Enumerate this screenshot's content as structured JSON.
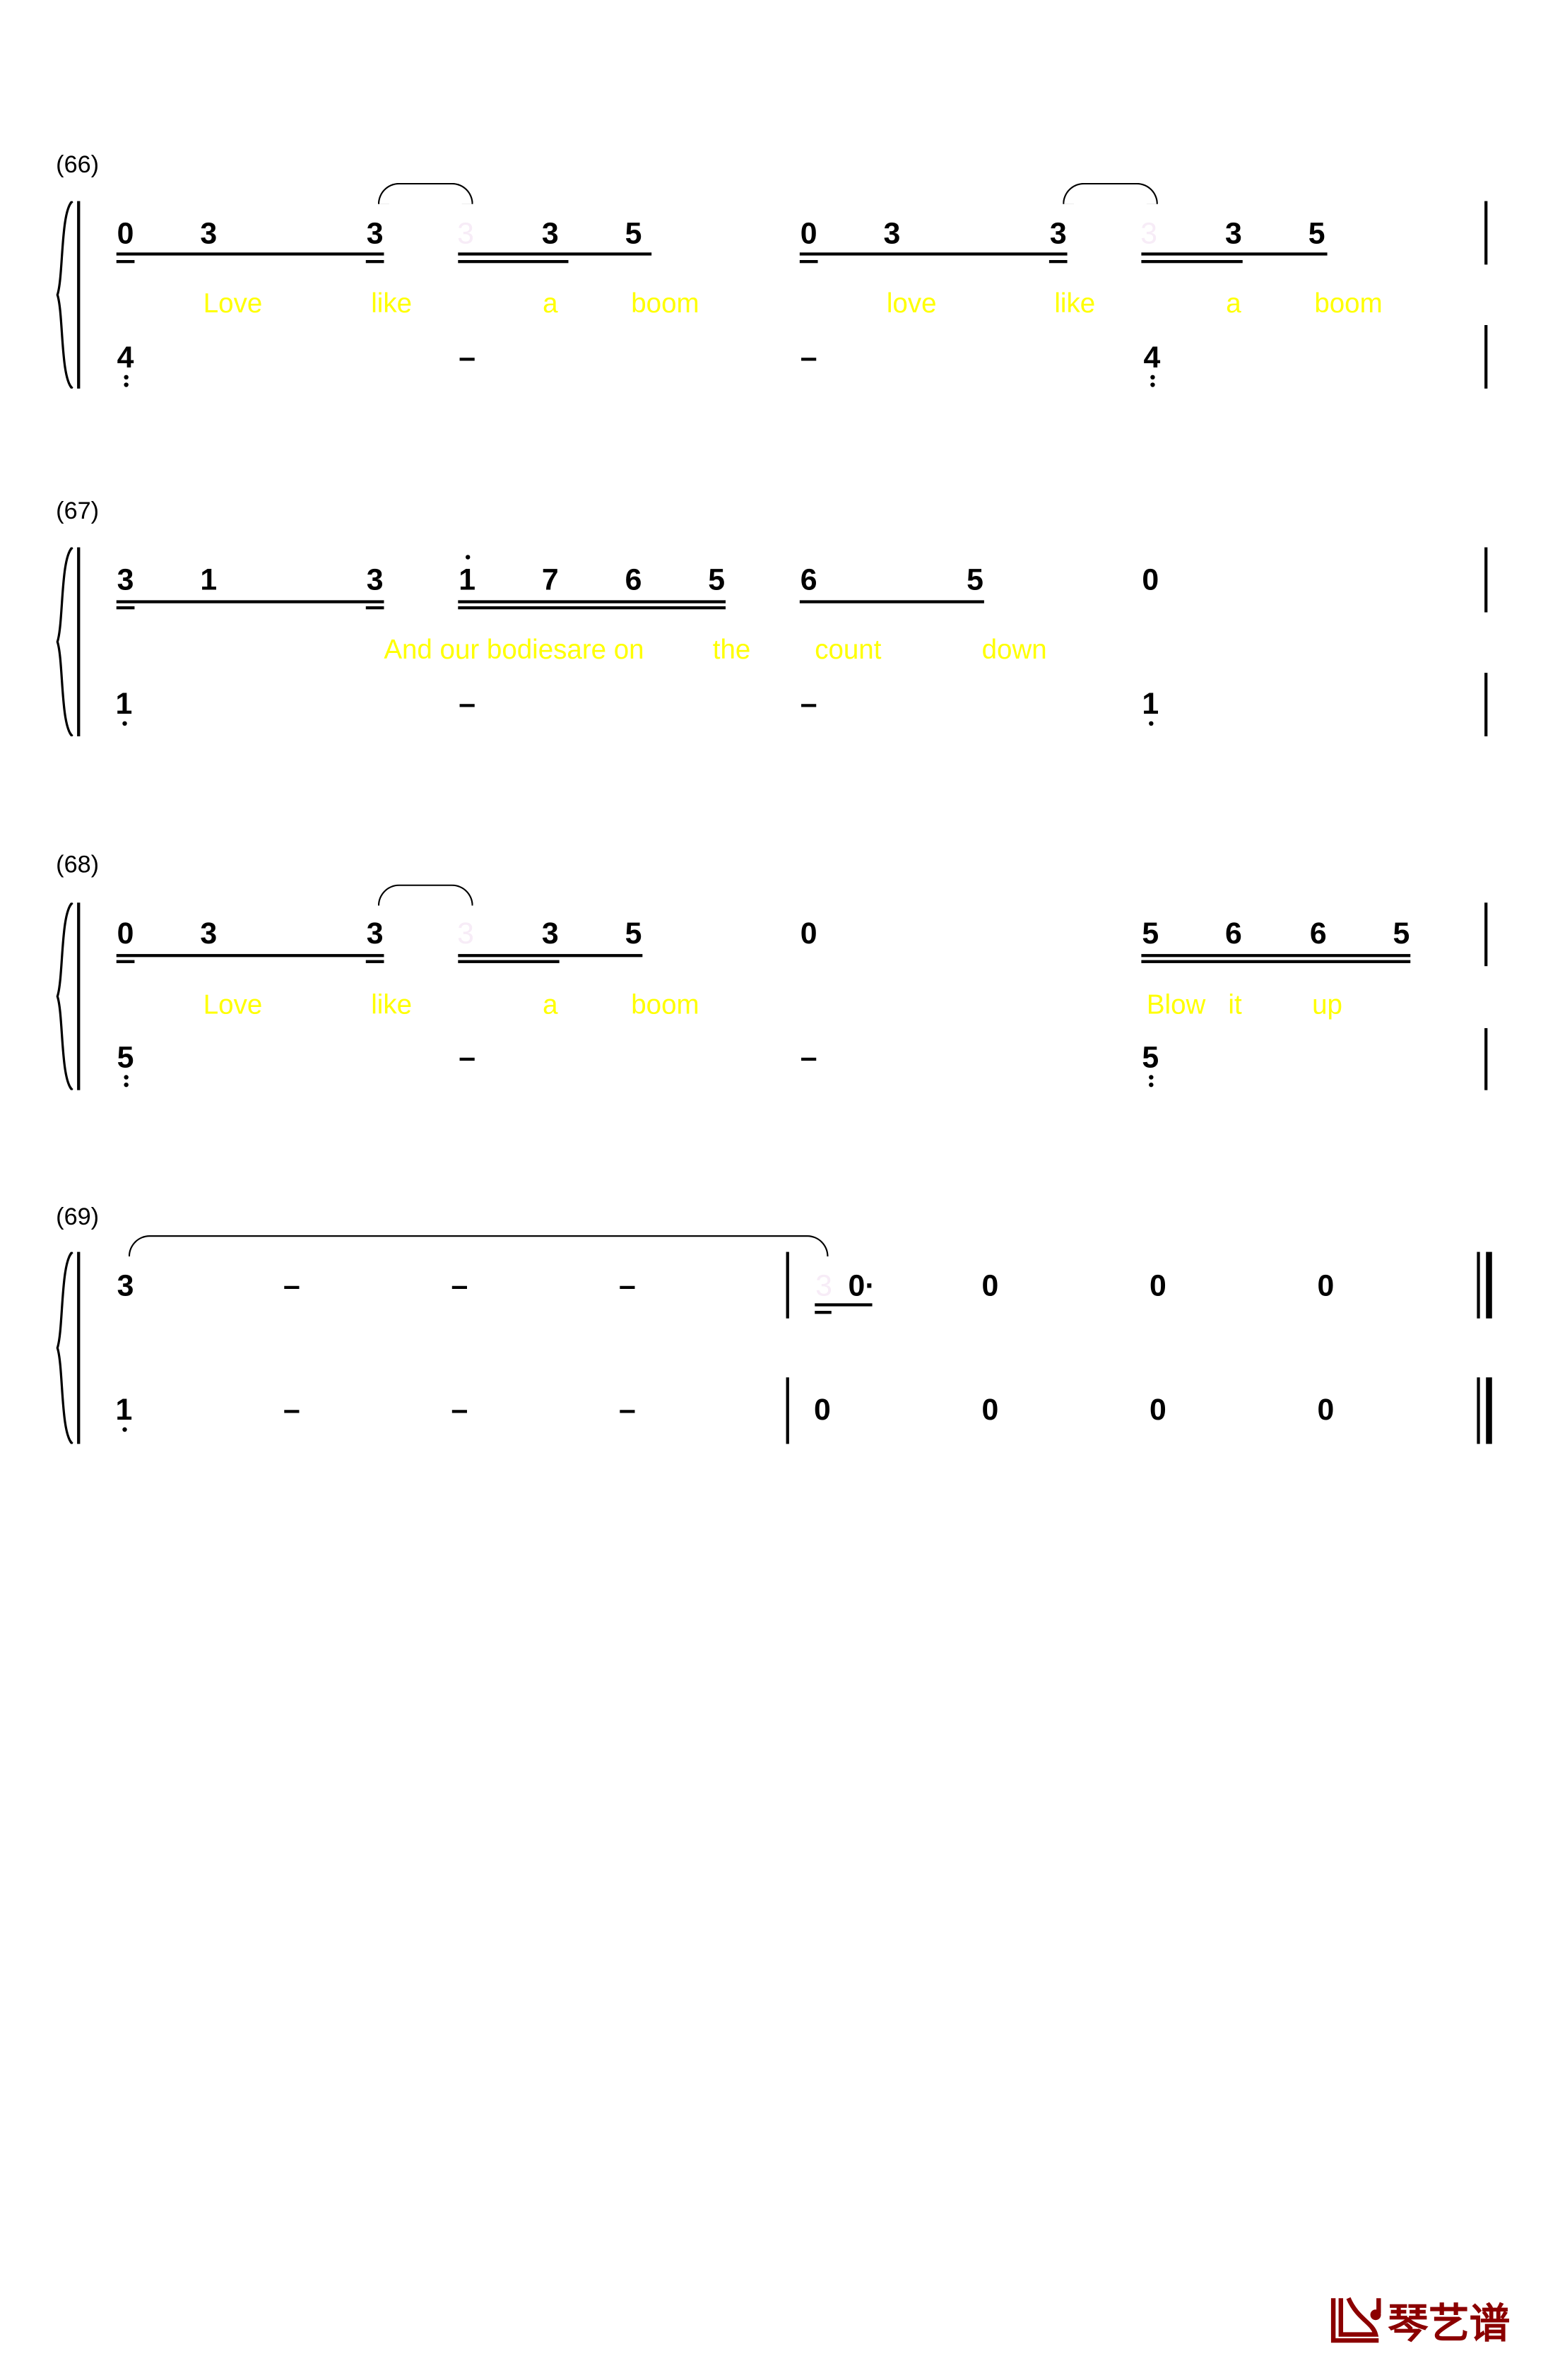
{
  "systems": [
    {
      "measure_label": "(66)",
      "upper": [
        {
          "text": "0"
        },
        {
          "text": "3"
        },
        {
          "text": "3"
        },
        {
          "text": "3",
          "faint": true
        },
        {
          "text": "3"
        },
        {
          "text": "5"
        },
        {
          "text": "0"
        },
        {
          "text": "3"
        },
        {
          "text": "3"
        },
        {
          "text": "3",
          "faint": true
        },
        {
          "text": "3"
        },
        {
          "text": "5"
        }
      ],
      "lyrics": [
        "Love",
        "like",
        "a",
        "boom",
        "love",
        "like",
        "a",
        "boom"
      ],
      "lower": [
        {
          "text": "4",
          "dots_below": 2
        },
        {
          "text": "–"
        },
        {
          "text": "–"
        },
        {
          "text": "4",
          "dots_below": 2
        }
      ]
    },
    {
      "measure_label": "(67)",
      "upper": [
        {
          "text": "3"
        },
        {
          "text": "1"
        },
        {
          "text": "3"
        },
        {
          "text": "1",
          "dot_above": 1
        },
        {
          "text": "7"
        },
        {
          "text": "6"
        },
        {
          "text": "5"
        },
        {
          "text": "6"
        },
        {
          "text": "5"
        },
        {
          "text": "0"
        }
      ],
      "lyrics": [
        "And our bodiesare on",
        "the",
        "count",
        "down"
      ],
      "lower": [
        {
          "text": "1",
          "dots_below": 1
        },
        {
          "text": "–"
        },
        {
          "text": "–"
        },
        {
          "text": "1",
          "dots_below": 1
        }
      ]
    },
    {
      "measure_label": "(68)",
      "upper": [
        {
          "text": "0"
        },
        {
          "text": "3"
        },
        {
          "text": "3"
        },
        {
          "text": "3",
          "faint": true
        },
        {
          "text": "3"
        },
        {
          "text": "5"
        },
        {
          "text": "0"
        },
        {
          "text": "5"
        },
        {
          "text": "6"
        },
        {
          "text": "6"
        },
        {
          "text": "5"
        }
      ],
      "lyrics": [
        "Love",
        "like",
        "a",
        "boom",
        "Blow",
        "it",
        "up"
      ],
      "lower": [
        {
          "text": "5",
          "dots_below": 2
        },
        {
          "text": "–"
        },
        {
          "text": "–"
        },
        {
          "text": "5",
          "dots_below": 2
        }
      ]
    },
    {
      "measure_label": "(69)",
      "upper": [
        {
          "text": "3"
        },
        {
          "text": "–"
        },
        {
          "text": "–"
        },
        {
          "text": "–"
        },
        {
          "text": "3",
          "faint": true
        },
        {
          "text": "0·"
        },
        {
          "text": "0"
        },
        {
          "text": "0"
        },
        {
          "text": "0"
        }
      ],
      "lyrics": [],
      "lower": [
        {
          "text": "1",
          "dots_below": 1
        },
        {
          "text": "–"
        },
        {
          "text": "–"
        },
        {
          "text": "–"
        },
        {
          "text": "0"
        },
        {
          "text": "0"
        },
        {
          "text": "0"
        },
        {
          "text": "0"
        }
      ]
    }
  ],
  "logo": {
    "text": "琴艺谱",
    "color": "#8b0000"
  },
  "colors": {
    "lyrics": "#ffff00",
    "notes": "#000000"
  }
}
